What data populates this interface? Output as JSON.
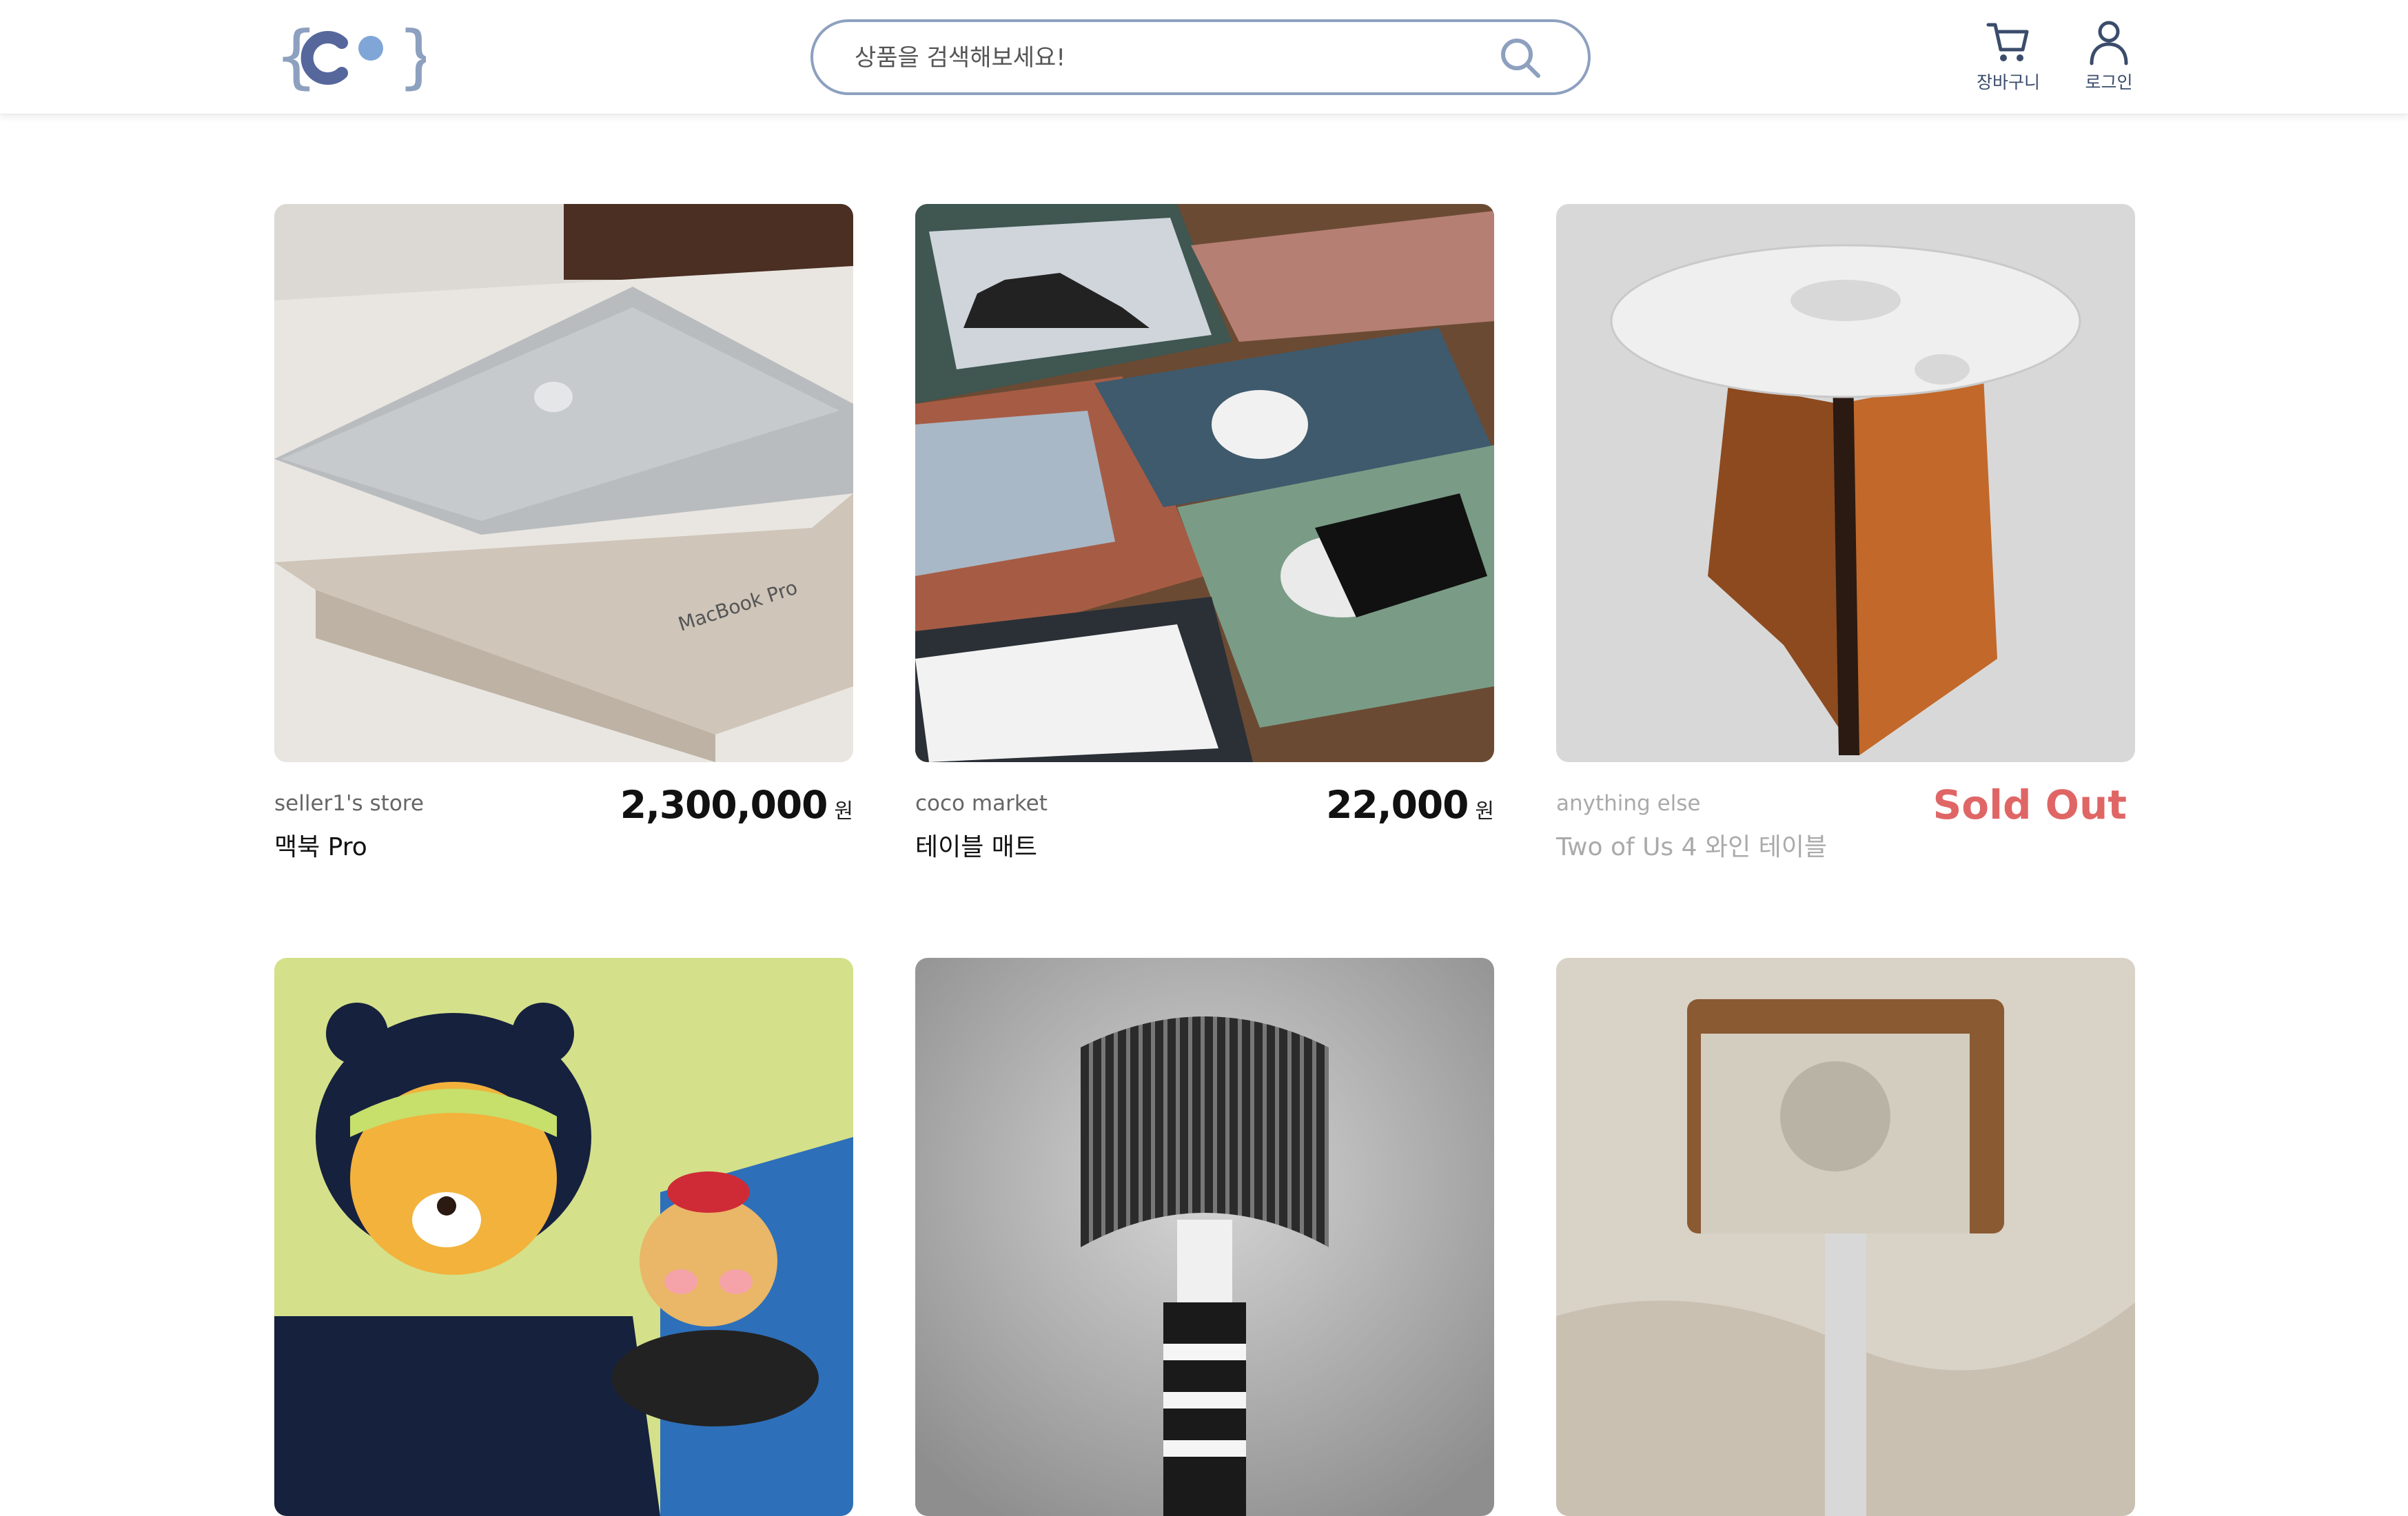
{
  "header": {
    "search": {
      "placeholder": "상품을 검색해보세요!"
    },
    "cart_label": "장바구니",
    "login_label": "로그인"
  },
  "products": [
    {
      "store": "seller1's store",
      "name": "맥북 Pro",
      "price": "2,300,000",
      "unit": "원",
      "image": "macbook-pro-box-photo"
    },
    {
      "store": "coco market",
      "name": "테이블 매트",
      "price": "22,000",
      "unit": "원",
      "image": "desk-mats-photo"
    },
    {
      "store": "anything else",
      "name": "Two of Us 4 와인 테이블",
      "status": "Sold Out",
      "image": "wine-table-photo"
    },
    {
      "image": "plush-toy-photo"
    },
    {
      "image": "lamp-photo"
    },
    {
      "image": "wooden-speaker-photo"
    }
  ],
  "colors": {
    "accent": "#8da0bf",
    "sold_out": "#e06666",
    "logo": "#5a6b9e"
  }
}
